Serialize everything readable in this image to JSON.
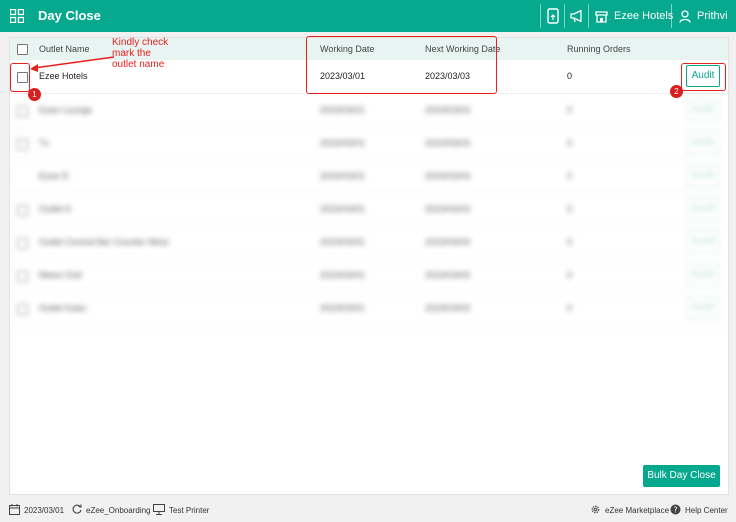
{
  "header": {
    "title": "Day Close",
    "property_label": "Ezee Hotels",
    "user_label": "Prithvi"
  },
  "table": {
    "columns": {
      "outlet": "Outlet Name",
      "working_date": "Working Date",
      "next_working_date": "Next Working Date",
      "running_orders": "Running Orders"
    },
    "first_row": {
      "outlet": "Ezee Hotels",
      "working_date": "2023/03/01",
      "next_working_date": "2023/03/03",
      "running_orders": "0",
      "action": "Audit"
    },
    "blurred_rows": [
      {
        "outlet": "Ezee Lounge",
        "working_date": "2023/03/01",
        "next_working_date": "2023/03/03",
        "running_orders": "0"
      },
      {
        "outlet": "Tx",
        "working_date": "2023/03/01",
        "next_working_date": "2023/03/03",
        "running_orders": "0"
      },
      {
        "outlet": "Ezee D",
        "working_date": "2023/03/01",
        "next_working_date": "2023/03/03",
        "running_orders": "0"
      },
      {
        "outlet": "Outlet A",
        "working_date": "2023/03/01",
        "next_working_date": "2023/03/03",
        "running_orders": "0"
      },
      {
        "outlet": "Outlet Central Bar Counter West",
        "working_date": "2023/03/01",
        "next_working_date": "2023/03/03",
        "running_orders": "0"
      },
      {
        "outlet": "Mews Outl",
        "working_date": "2023/03/01",
        "next_working_date": "2023/03/03",
        "running_orders": "0"
      },
      {
        "outlet": "Outlet Kaan",
        "working_date": "2023/03/01",
        "next_working_date": "2023/03/03",
        "running_orders": "0"
      }
    ],
    "blurred_action": "Audit"
  },
  "bulk_day_close": "Bulk Day Close",
  "annotation": {
    "note": "Kindly check mark the outlet name",
    "note_lines": [
      "Kindly check",
      "mark the",
      "outlet name"
    ],
    "marker_1": "1",
    "marker_2": "2"
  },
  "footer": {
    "date": "2023/03/01",
    "onboarding": "eZee_Onboarding",
    "printer": "Test Printer",
    "marketplace": "eZee Marketplace",
    "help": "Help Center"
  },
  "colors": {
    "brand": "#06a88e",
    "annotation": "#e8201e"
  }
}
